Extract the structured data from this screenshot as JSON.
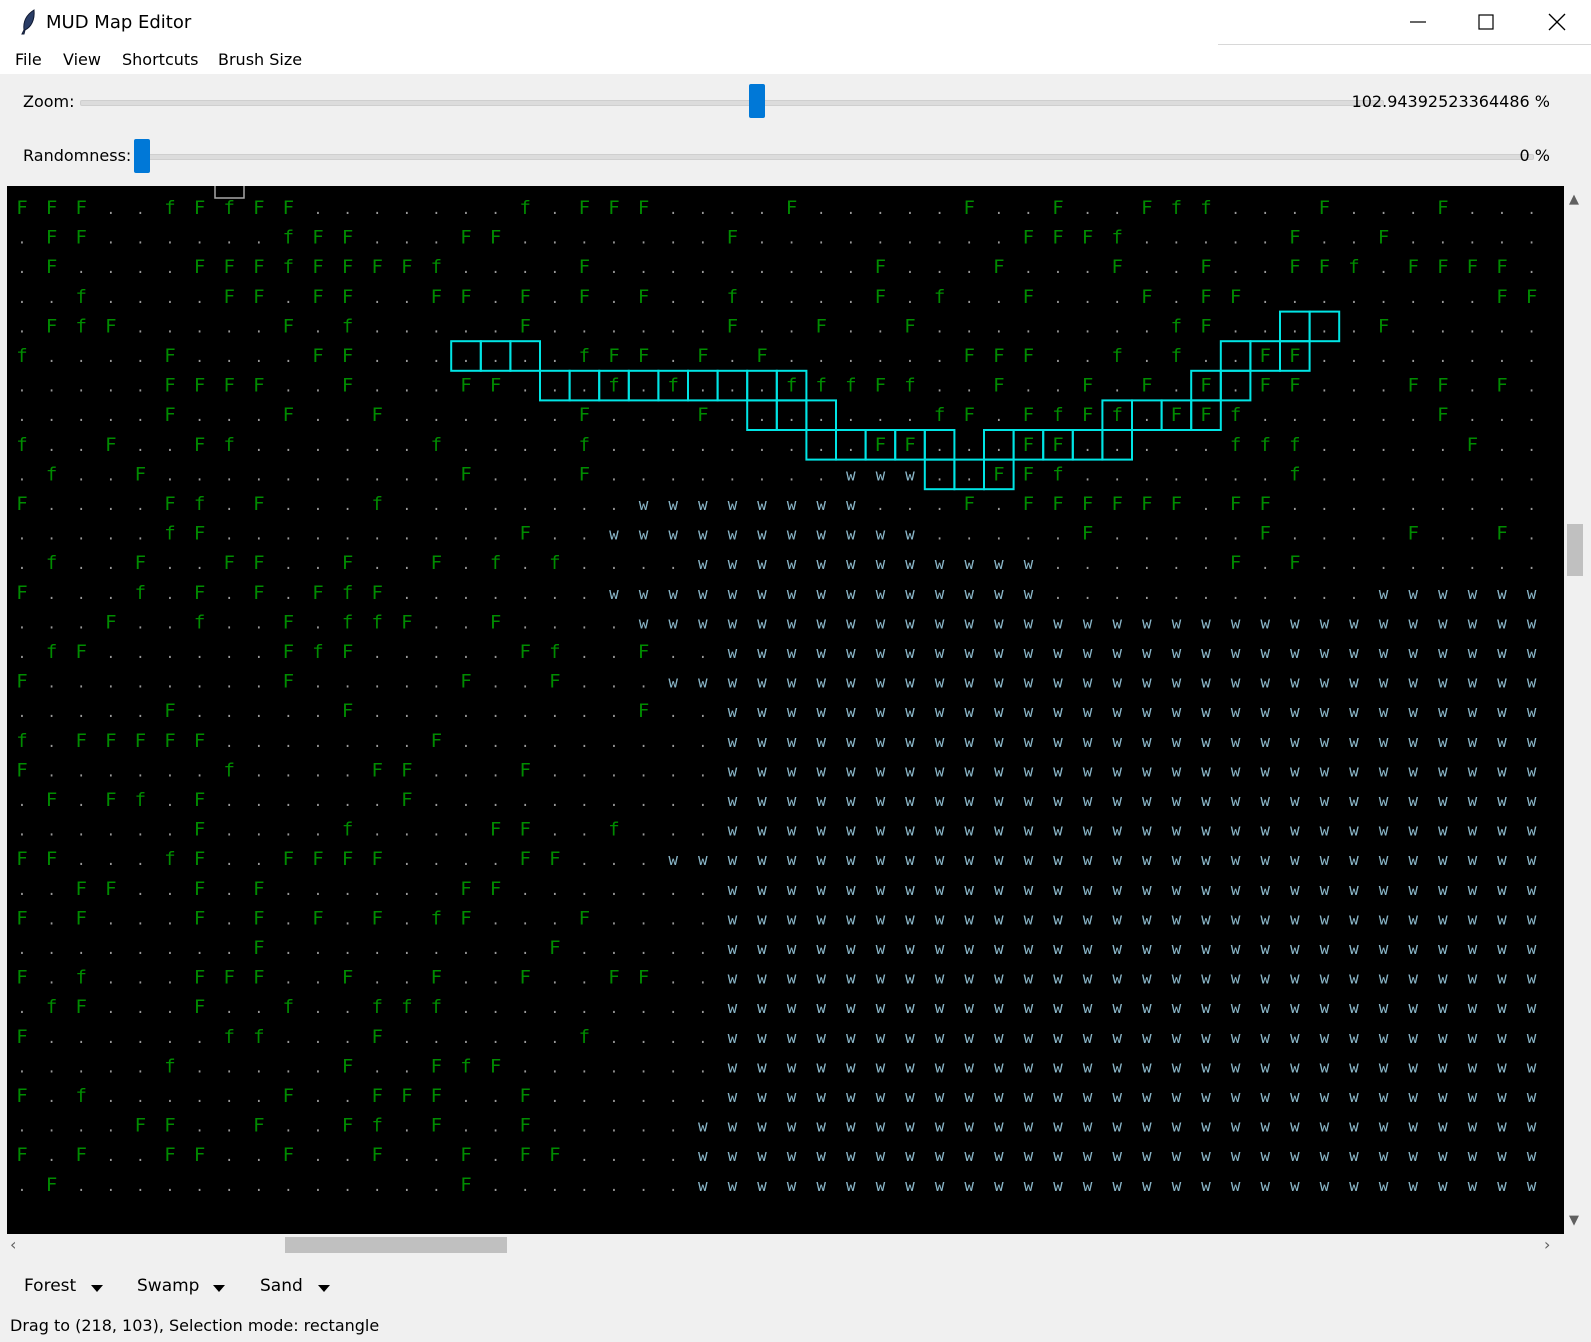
{
  "window": {
    "title": "MUD Map Editor",
    "icon": "feather-icon",
    "controls": [
      "minimize-icon",
      "maximize-icon",
      "close-icon"
    ]
  },
  "menubar": {
    "items": [
      "File",
      "View",
      "Shortcuts",
      "Brush Size"
    ]
  },
  "zoom": {
    "label": "Zoom:",
    "value_text": "102.94392523364486 %",
    "fraction": 0.52
  },
  "randomness": {
    "label": "Randomness:",
    "value_text": "0 %",
    "fraction": 0.0
  },
  "map": {
    "grid_rows": [
      "FFF..fFfFF.......f.FFF....F.....F..F..Fff...F...F.....fFF.F",
      ".FF......fFF...FF.......F.........FFFf.....F..F...........",
      ".F....FFFfFFFFf....F.........F...F...F..F..FFf.FFFF.FF.....",
      "..f....FF.FF..FF.F.F.F..f....F.f..F...F.FF........FF..f..fF",
      ".FfF.....F.f.....F......F..F..F........fF.....F.......F..Ff",
      "f....F....FF.......fFF.F.F......FFF..f.f..FF..........fFfF.FFFF.F",
      ".....FFFF..F...FF...f.f...fffFf..F..F.F.F.FF...FF.F.F..F....",
      ".....F...F..F......F...F.......fF.FfFf.FFf......F....F....W",
      "f..F..Ff......f....f.........FF...FF.....fff.....F...f..f..WWW",
      ".f..F..........F...F........WWW..FFf.......f.........F.....WWWW",
      "F....Ff.F...f........WWWWWWWW...F.FFFFFF.FF.........F..WWWWWW",
      ".....fF..........F..WWWWWWWWWWW.....F.....F....F..F..WWWWWW",
      ".f..F..FF..F..F.f.f....WWWWWWWWWWWW......F.F...........WWWWWWWW",
      "F...f.F.F.FfF.......WWWWWWWWWWWWWWW...........WWWWWWWWWWWW",
      "...F..f..F.ffF..F....WWWWWWWWWWWWWWWWWWWWWWWWWWWWWWWWWWW",
      ".fF......FfF.....Ff..F..WWWWWWWWWWWWWWWWWWWWWWWWWWWWWWWWW",
      "F........F.....F..F...WWWWWWWWWWWWWWWWWWWWWWWWWWWWWWWWW",
      ".....F.....F.........F..WWWWWWWWWWWWWWWWWWWWWWWWWWWWWWWWW",
      "f.FFFFF.......F.........WWWWWWWWWWWWWWWWWWWWWWWWWWWWWWWWW",
      "F......f....FF...F......WWWWWWWWWWWWWWWWWWWWWWWWWWWWWWWWW",
      ".F.Ff.F......F..........WWWWWWWWWWWWWWWWWWWWWWWWWWWWWWWWW",
      "......F....f....FF..f...WWWWWWWWWWWWWWWWWWWWWWWWWWWWWWWWW",
      "FF...fF..FFFF....FF...WWWWWWWWWWWWWWWWWWWWWWWWWWWWWWWWW",
      "..FF..F.F......FF.......WWWWWWWWWWWWWWWWWWWWWWWWWWWWWWWWW",
      "F.F...F.F.F.F.fF...F....WWWWWWWWWWWWWWWWWWWWWWWWWWWWWWWWW",
      "........F.........F.....WWWWWWWWWWWWWWWWWWWWWWWWWWWWWWWWW",
      "F.f...FFF..F..F..F..FF..WWWWWWWWWWWWWWWWWWWWWWWWWWWWWWWWW",
      ".fF...F..f..fff.........WWWWWWWWWWWWWWWWWWWWWWWWWWWWWWWWW",
      "F......ff...F......f....WWWWWWWWWWWWWWWWWWWWWWWWWWWWWWWWW",
      ".....f.....F..FfF.......WWWWWWWWWWWWWWWWWWWWWWWWWWWWWWWWW",
      "F.f......F..FFF..F......WWWWWWWWWWWWWWWWWWWWWWWWWWWWWWWWW",
      "....FF..F..Ff.F..F.....WWWWWWWWWWWWWWWWWWWWWWWWWWWWWWWWWW",
      "F.F..FF..F..F..F.FF....WWWWWWWWWWWWWWWWWWWWWWWWWWWWWWWWWW",
      ".F.............F.......WWWWWWWWWWWWWWWWWWWWWWWWWWWWWWWWWW"
    ],
    "colors": {
      "forest": "#008c00",
      "swamp": "#8ab6c8",
      "empty": "#9a9a9a",
      "selection": "#00e5e5",
      "cursor": "#a8a8a8",
      "background": "#000000"
    }
  },
  "brushes": [
    {
      "label": "Forest"
    },
    {
      "label": "Swamp"
    },
    {
      "label": "Sand"
    }
  ],
  "status": {
    "text": "Drag to (218, 103), Selection mode: rectangle"
  }
}
